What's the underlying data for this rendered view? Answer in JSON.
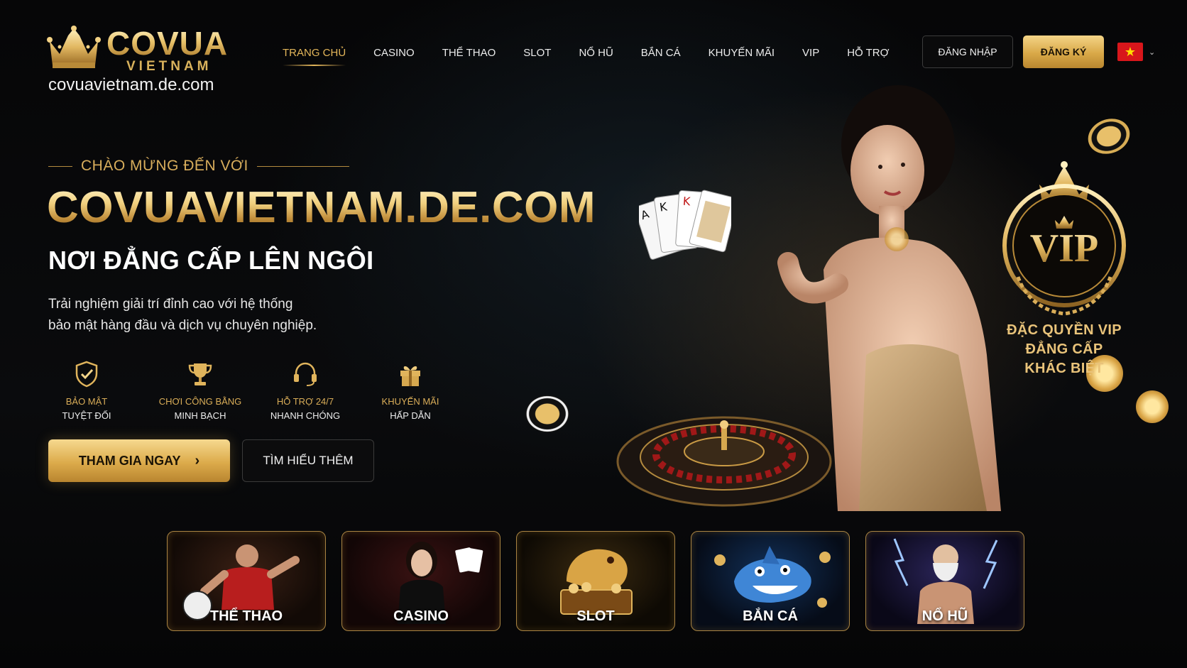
{
  "logo": {
    "brand_top": "COVUA",
    "brand_bottom": "VIETNAM",
    "domain": "covuavietnam.de.com"
  },
  "nav": {
    "items": [
      {
        "label": "TRANG CHỦ",
        "active": true
      },
      {
        "label": "CASINO"
      },
      {
        "label": "THỂ THAO"
      },
      {
        "label": "SLOT"
      },
      {
        "label": "NỔ HŨ"
      },
      {
        "label": "BẮN CÁ"
      },
      {
        "label": "KHUYẾN MÃI"
      },
      {
        "label": "VIP"
      },
      {
        "label": "HỖ TRỢ"
      }
    ]
  },
  "header": {
    "login_label": "ĐĂNG NHẬP",
    "register_label": "ĐĂNG KÝ",
    "language_flag_icon": "vietnam-flag-icon"
  },
  "hero": {
    "welcome": "CHÀO MỪNG ĐẾN VỚI",
    "title": "COVUAVIETNAM.DE.COM",
    "subtitle": "NƠI ĐẲNG CẤP LÊN NGÔI",
    "description_line1": "Trải nghiệm giải trí đỉnh cao với hệ thống",
    "description_line2": "bảo mật hàng đầu và dịch vụ chuyên nghiệp.",
    "join_label": "THAM GIA NGAY",
    "more_label": "TÌM HIỂU THÊM"
  },
  "features": [
    {
      "icon": "shield-check-icon",
      "line1": "BẢO MẬT",
      "line2": "TUYỆT ĐỐI"
    },
    {
      "icon": "trophy-icon",
      "line1": "CHƠI CÔNG BẰNG",
      "line2": "MINH BẠCH"
    },
    {
      "icon": "headset-icon",
      "line1": "HỖ TRỢ 24/7",
      "line2": "NHANH CHÓNG"
    },
    {
      "icon": "gift-icon",
      "line1": "KHUYẾN MÃI",
      "line2": "HẤP DẪN"
    }
  ],
  "vip": {
    "badge": "VIP",
    "line1": "ĐẶC QUYỀN VIP",
    "line2": "ĐẲNG CẤP",
    "line3": "KHÁC BIỆT"
  },
  "categories": [
    {
      "label": "THỂ THAO",
      "icon": "football-player-icon"
    },
    {
      "label": "CASINO",
      "icon": "casino-dealer-icon"
    },
    {
      "label": "SLOT",
      "icon": "dragon-treasure-icon"
    },
    {
      "label": "BẮN CÁ",
      "icon": "shark-icon"
    },
    {
      "label": "NỔ HŨ",
      "icon": "zeus-icon"
    }
  ],
  "colors": {
    "gold": "#e3b65a",
    "background": "#050506",
    "flag_red": "#d8161b",
    "flag_star": "#ffde00"
  }
}
